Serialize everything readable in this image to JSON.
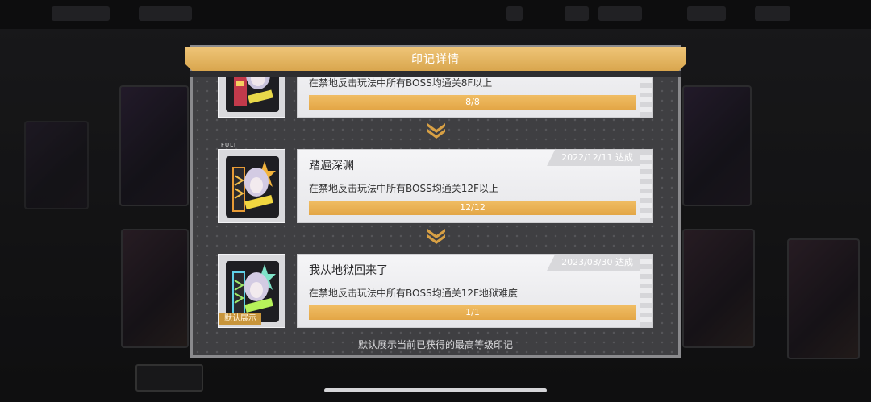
{
  "modal": {
    "title": "印记详情",
    "footer_note": "默认展示当前已获得的最高等级印记"
  },
  "entries": [
    {
      "name": "",
      "description": "在禁地反击玩法中所有BOSS均通关8F以上",
      "progress_text": "8/8",
      "progress": 1.0,
      "date": ""
    },
    {
      "name": "踏遍深渊",
      "description": "在禁地反击玩法中所有BOSS均通关12F以上",
      "progress_text": "12/12",
      "progress": 1.0,
      "date": "2022/12/11 达成",
      "badge_text": "FULI"
    },
    {
      "name": "我从地狱回来了",
      "description": "在禁地反击玩法中所有BOSS均通关12F地狱难度",
      "progress_text": "1/1",
      "progress": 1.0,
      "date": "2023/03/30 达成",
      "default_tag": "默认展示"
    }
  ],
  "colors": {
    "accent_gold": "#e3a646",
    "panel_gray": "#3f3f42"
  },
  "icons": [
    "chevron-double-down-icon",
    "emblem-icon"
  ]
}
